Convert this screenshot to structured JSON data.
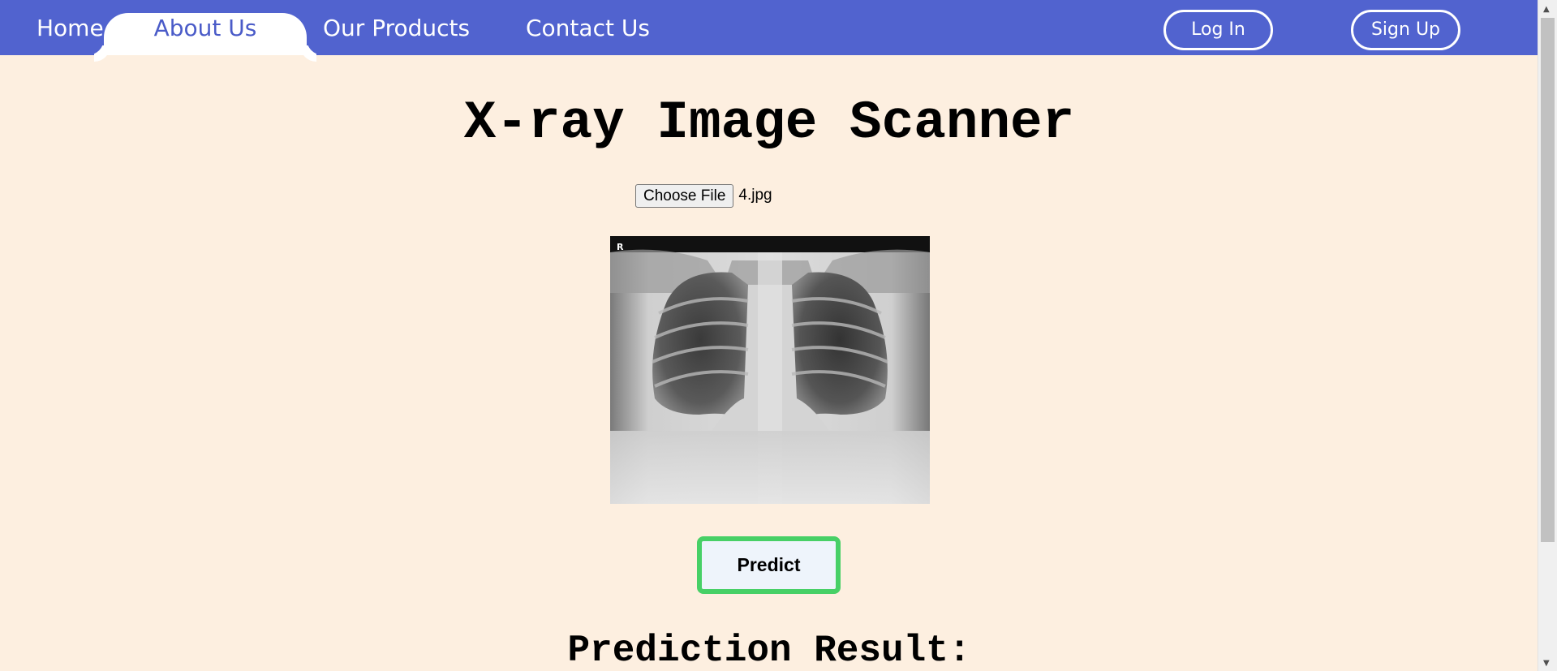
{
  "nav": {
    "home": "Home",
    "about": "About Us",
    "products": "Our Products",
    "contact": "Contact Us",
    "login": "Log In",
    "signup": "Sign Up"
  },
  "main": {
    "title": "X-ray Image Scanner",
    "choose_file_label": "Choose File",
    "file_name": "4.jpg",
    "xray_marker": "R",
    "predict_label": "Predict",
    "result_heading": "Prediction Result:"
  },
  "colors": {
    "nav_bg": "#5163cf",
    "page_bg": "#fdefe0",
    "active_tab_text": "#4a5bc8",
    "predict_border": "#47d066",
    "predict_bg": "#eef4fb"
  }
}
